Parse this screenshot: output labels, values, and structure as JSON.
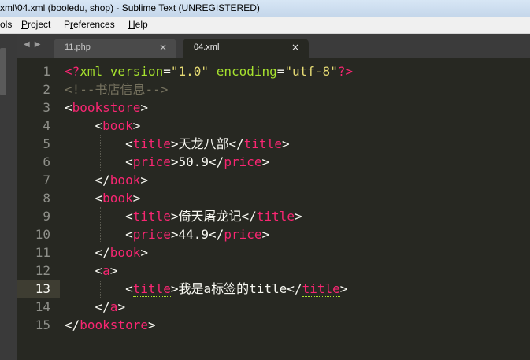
{
  "window": {
    "title": "xml\\04.xml (booledu, shop) - Sublime Text (UNREGISTERED)"
  },
  "menu": [
    {
      "label": "ols",
      "underline_index": -1
    },
    {
      "label": "Project",
      "underline_index": 0
    },
    {
      "label": "Preferences",
      "underline_index": 1
    },
    {
      "label": "Help",
      "underline_index": 0
    }
  ],
  "tabs": [
    {
      "label": "11.php",
      "close": "×",
      "active": false
    },
    {
      "label": "04.xml",
      "close": "×",
      "active": true
    }
  ],
  "nav": {
    "arrows": "◀▶"
  },
  "editor": {
    "current_line": 13,
    "line_numbers": [
      "1",
      "2",
      "3",
      "4",
      "5",
      "6",
      "7",
      "8",
      "9",
      "10",
      "11",
      "12",
      "13",
      "14",
      "15"
    ],
    "lines": [
      [
        [
          "tag",
          "<?"
        ],
        [
          "attr",
          "xml version"
        ],
        [
          "txt",
          "="
        ],
        [
          "str",
          "\"1.0\""
        ],
        [
          "txt",
          " "
        ],
        [
          "attr",
          "encoding"
        ],
        [
          "txt",
          "="
        ],
        [
          "str",
          "\"utf-8\""
        ],
        [
          "tag",
          "?>"
        ]
      ],
      [
        [
          "cmt",
          "<!--书店信息-->"
        ]
      ],
      [
        [
          "txt",
          "<"
        ],
        [
          "tag",
          "bookstore"
        ],
        [
          "txt",
          ">"
        ]
      ],
      [
        [
          "txt",
          "    <"
        ],
        [
          "tag",
          "book"
        ],
        [
          "txt",
          ">"
        ]
      ],
      [
        [
          "txt",
          "        <"
        ],
        [
          "tag",
          "title"
        ],
        [
          "txt",
          ">天龙八部</"
        ],
        [
          "tag",
          "title"
        ],
        [
          "txt",
          ">"
        ]
      ],
      [
        [
          "txt",
          "        <"
        ],
        [
          "tag",
          "price"
        ],
        [
          "txt",
          ">50.9</"
        ],
        [
          "tag",
          "price"
        ],
        [
          "txt",
          ">"
        ]
      ],
      [
        [
          "txt",
          "    </"
        ],
        [
          "tag",
          "book"
        ],
        [
          "txt",
          ">"
        ]
      ],
      [
        [
          "txt",
          "    <"
        ],
        [
          "tag",
          "book"
        ],
        [
          "txt",
          ">"
        ]
      ],
      [
        [
          "txt",
          "        <"
        ],
        [
          "tag",
          "title"
        ],
        [
          "txt",
          ">倚天屠龙记</"
        ],
        [
          "tag",
          "title"
        ],
        [
          "txt",
          ">"
        ]
      ],
      [
        [
          "txt",
          "        <"
        ],
        [
          "tag",
          "price"
        ],
        [
          "txt",
          ">44.9</"
        ],
        [
          "tag",
          "price"
        ],
        [
          "txt",
          ">"
        ]
      ],
      [
        [
          "txt",
          "    </"
        ],
        [
          "tag",
          "book"
        ],
        [
          "txt",
          ">"
        ]
      ],
      [
        [
          "txt",
          "    <"
        ],
        [
          "tag",
          "a"
        ],
        [
          "txt",
          ">"
        ]
      ],
      [
        [
          "txt",
          "        <"
        ],
        [
          "tag hl",
          "title"
        ],
        [
          "txt",
          ">我是a标签的title</"
        ],
        [
          "tag hl",
          "title"
        ],
        [
          "txt",
          ">"
        ]
      ],
      [
        [
          "txt",
          "    </"
        ],
        [
          "tag",
          "a"
        ],
        [
          "txt",
          ">"
        ]
      ],
      [
        [
          "txt",
          "</"
        ],
        [
          "tag",
          "bookstore"
        ],
        [
          "txt",
          ">"
        ]
      ]
    ]
  },
  "colors": {
    "background": "#272822",
    "tag": "#f92672",
    "attribute": "#a6e22e",
    "string": "#e6db74",
    "comment": "#75715e",
    "text": "#f8f8f2"
  }
}
